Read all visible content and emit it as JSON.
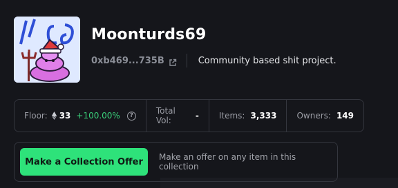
{
  "collection": {
    "name": "Moonturds69",
    "address": "0xb469...735B",
    "description": "Community based shit project.",
    "avatar_icon": "moonturd-avatar"
  },
  "stats": {
    "floor_label": "Floor:",
    "floor_value": "33",
    "floor_change": "+100.00%",
    "total_vol_label": "Total Vol:",
    "total_vol_value": "-",
    "items_label": "Items:",
    "items_value": "3,333",
    "owners_label": "Owners:",
    "owners_value": "149"
  },
  "offer": {
    "button_label": "Make a Collection Offer",
    "hint": "Make an offer on any item in this collection"
  },
  "colors": {
    "background": "#15161b",
    "accent_green": "#2ee27a",
    "positive_change": "#3ad07a"
  }
}
